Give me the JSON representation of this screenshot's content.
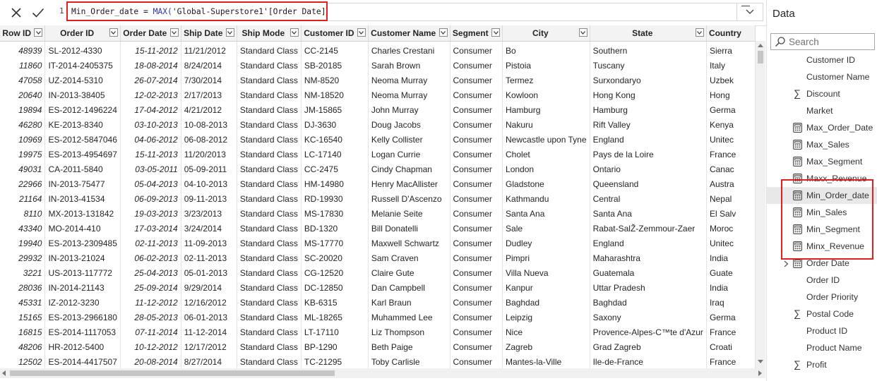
{
  "formula": {
    "line_number": "1",
    "measure_name": "Min_Order_date",
    "operator": " = ",
    "function": "MAX(",
    "table_ref": "'Global-Superstore1'",
    "column_ref": "[Order Date]",
    "close": ")"
  },
  "table": {
    "columns": [
      "Row ID",
      "Order ID",
      "Order Date",
      "Ship Date",
      "Ship Mode",
      "Customer ID",
      "Customer Name",
      "Segment",
      "City",
      "State",
      "Country"
    ],
    "rows": [
      [
        "48939",
        "SL-2012-4330",
        "15-11-2012",
        "11/21/2012",
        "Standard Class",
        "CC-2145",
        "Charles Crestani",
        "Consumer",
        "Bo",
        "Southern",
        "Sierra"
      ],
      [
        "11860",
        "IT-2014-2405375",
        "18-08-2014",
        "8/24/2014",
        "Standard Class",
        "SB-20185",
        "Sarah Brown",
        "Consumer",
        "Pistoia",
        "Tuscany",
        "Italy"
      ],
      [
        "47058",
        "UZ-2014-5310",
        "26-07-2014",
        "7/30/2014",
        "Standard Class",
        "NM-8520",
        "Neoma Murray",
        "Consumer",
        "Termez",
        "Surxondaryo",
        "Uzbek"
      ],
      [
        "20640",
        "IN-2013-38405",
        "12-02-2013",
        "2/17/2013",
        "Standard Class",
        "NM-18520",
        "Neoma Murray",
        "Consumer",
        "Kowloon",
        "Hong Kong",
        "Hong"
      ],
      [
        "19894",
        "ES-2012-1496224",
        "17-04-2012",
        "4/21/2012",
        "Standard Class",
        "JM-15865",
        "John Murray",
        "Consumer",
        "Hamburg",
        "Hamburg",
        "Germa"
      ],
      [
        "46280",
        "KE-2013-8340",
        "03-10-2013",
        "10-08-2013",
        "Standard Class",
        "DJ-3630",
        "Doug Jacobs",
        "Consumer",
        "Nakuru",
        "Rift Valley",
        "Kenya"
      ],
      [
        "10969",
        "ES-2012-5847046",
        "04-06-2012",
        "06-08-2012",
        "Standard Class",
        "KC-16540",
        "Kelly Collister",
        "Consumer",
        "Newcastle upon Tyne",
        "England",
        "Unitec"
      ],
      [
        "19975",
        "ES-2013-4954697",
        "15-11-2013",
        "11/20/2013",
        "Standard Class",
        "LC-17140",
        "Logan Currie",
        "Consumer",
        "Cholet",
        "Pays de la Loire",
        "France"
      ],
      [
        "49031",
        "CA-2011-5840",
        "03-05-2011",
        "05-09-2011",
        "Standard Class",
        "CC-2475",
        "Cindy Chapman",
        "Consumer",
        "London",
        "Ontario",
        "Canac"
      ],
      [
        "22966",
        "IN-2013-75477",
        "05-04-2013",
        "04-10-2013",
        "Standard Class",
        "HM-14980",
        "Henry MacAllister",
        "Consumer",
        "Gladstone",
        "Queensland",
        "Austra"
      ],
      [
        "21164",
        "IN-2013-41534",
        "06-09-2013",
        "09-11-2013",
        "Standard Class",
        "RD-19930",
        "Russell D'Ascenzo",
        "Consumer",
        "Kathmandu",
        "Central",
        "Nepal"
      ],
      [
        "8110",
        "MX-2013-131842",
        "19-03-2013",
        "3/23/2013",
        "Standard Class",
        "MS-17830",
        "Melanie Seite",
        "Consumer",
        "Santa Ana",
        "Santa Ana",
        "El Salv"
      ],
      [
        "43340",
        "MO-2014-410",
        "17-03-2014",
        "3/24/2014",
        "Standard Class",
        "BD-1320",
        "Bill Donatelli",
        "Consumer",
        "Sale",
        "Rabat-SalŽ-Zemmour-Zaer",
        "Moroc"
      ],
      [
        "19940",
        "ES-2013-2309485",
        "02-11-2013",
        "11-09-2013",
        "Standard Class",
        "MS-17770",
        "Maxwell Schwartz",
        "Consumer",
        "Dudley",
        "England",
        "Unitec"
      ],
      [
        "29932",
        "IN-2013-21024",
        "06-02-2013",
        "02-11-2013",
        "Standard Class",
        "SC-20020",
        "Sam Craven",
        "Consumer",
        "Pimpri",
        "Maharashtra",
        "India"
      ],
      [
        "3221",
        "US-2013-117772",
        "25-04-2013",
        "05-01-2013",
        "Standard Class",
        "CG-12520",
        "Claire Gute",
        "Consumer",
        "Villa Nueva",
        "Guatemala",
        "Guate"
      ],
      [
        "28036",
        "IN-2014-21143",
        "25-09-2014",
        "9/29/2014",
        "Standard Class",
        "DC-12850",
        "Dan Campbell",
        "Consumer",
        "Kanpur",
        "Uttar Pradesh",
        "India"
      ],
      [
        "45331",
        "IZ-2012-3230",
        "11-12-2012",
        "12/16/2012",
        "Standard Class",
        "KB-6315",
        "Karl Braun",
        "Consumer",
        "Baghdad",
        "Baghdad",
        "Iraq"
      ],
      [
        "15165",
        "ES-2013-2966180",
        "28-05-2013",
        "06-01-2013",
        "Standard Class",
        "ML-18265",
        "Muhammed Lee",
        "Consumer",
        "Leipzig",
        "Saxony",
        "Germa"
      ],
      [
        "16815",
        "ES-2014-1117053",
        "07-11-2014",
        "11-12-2014",
        "Standard Class",
        "LT-17110",
        "Liz Thompson",
        "Consumer",
        "Nice",
        "Provence-Alpes-C™te d'Azur",
        "France"
      ],
      [
        "48206",
        "HR-2012-5400",
        "10-12-2012",
        "12/17/2012",
        "Standard Class",
        "BP-1290",
        "Beth Paige",
        "Consumer",
        "Zagreb",
        "Grad Zagreb",
        "Croati"
      ],
      [
        "12502",
        "ES-2014-4417507",
        "20-08-2014",
        "8/27/2014",
        "Standard Class",
        "TC-21295",
        "Toby Carlisle",
        "Consumer",
        "Mantes-la-Ville",
        "Ile-de-France",
        "France"
      ]
    ]
  },
  "sidebar": {
    "title": "Data",
    "search_placeholder": "Search",
    "fields": [
      {
        "label": "Customer ID",
        "icon": "none"
      },
      {
        "label": "Customer Name",
        "icon": "none"
      },
      {
        "label": "Discount",
        "icon": "sigma"
      },
      {
        "label": "Market",
        "icon": "none"
      },
      {
        "label": "Max_Order_Date",
        "icon": "calculator"
      },
      {
        "label": "Max_Sales",
        "icon": "calculator"
      },
      {
        "label": "Max_Segment",
        "icon": "calculator"
      },
      {
        "label": "Maxx_Revenue",
        "icon": "calculator"
      },
      {
        "label": "Min_Order_date",
        "icon": "calculator"
      },
      {
        "label": "Min_Sales",
        "icon": "calculator"
      },
      {
        "label": "Min_Segment",
        "icon": "calculator"
      },
      {
        "label": "Minx_Revenue",
        "icon": "calculator"
      },
      {
        "label": "Order Date",
        "icon": "calendar-hierarchy"
      },
      {
        "label": "Order ID",
        "icon": "none"
      },
      {
        "label": "Order Priority",
        "icon": "none"
      },
      {
        "label": "Postal Code",
        "icon": "sigma"
      },
      {
        "label": "Product ID",
        "icon": "none"
      },
      {
        "label": "Product Name",
        "icon": "none"
      },
      {
        "label": "Profit",
        "icon": "sigma"
      }
    ]
  },
  "colors": {
    "highlight_border": "#e0211f",
    "dax_function": "#2b35b8",
    "selected_field": "#e8e8e8"
  }
}
